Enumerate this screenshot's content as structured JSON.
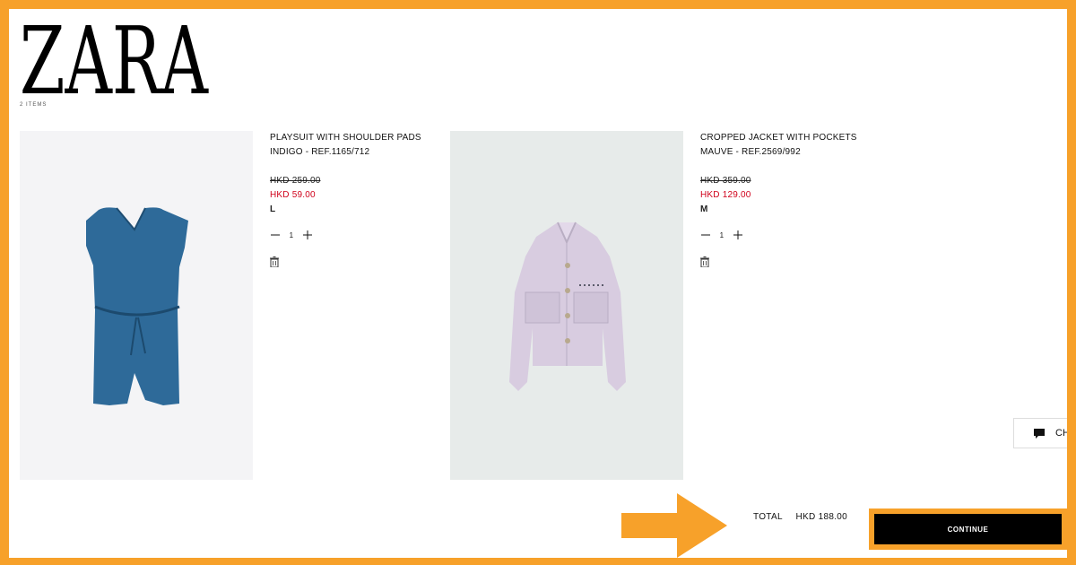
{
  "brand": {
    "logo_text": "ZARA",
    "sub_text": "2 ITEMS"
  },
  "cart": {
    "items": [
      {
        "name": "PLAYSUIT WITH SHOULDER PADS",
        "variant": "INDIGO - REF.1165/712",
        "old_price": "HKD 259.00",
        "new_price": "HKD 59.00",
        "size": "L",
        "quantity": "1",
        "image": "blue-playsuit"
      },
      {
        "name": "CROPPED JACKET WITH POCKETS",
        "variant": "MAUVE - REF.2569/992",
        "old_price": "HKD 359.00",
        "new_price": "HKD 129.00",
        "size": "M",
        "quantity": "1",
        "image": "mauve-cropped-jacket"
      }
    ]
  },
  "chat": {
    "label": "CH",
    "icon": "chat-bubble-icon"
  },
  "summary": {
    "total_label": "TOTAL",
    "total_amount": "HKD 188.00",
    "continue_label": "CONTINUE"
  },
  "colors": {
    "frame": "#f7a12a",
    "sale_price": "#d0021b",
    "button_bg": "#000000",
    "playsuit": "#2e6a99",
    "jacket": "#d8cce0"
  }
}
